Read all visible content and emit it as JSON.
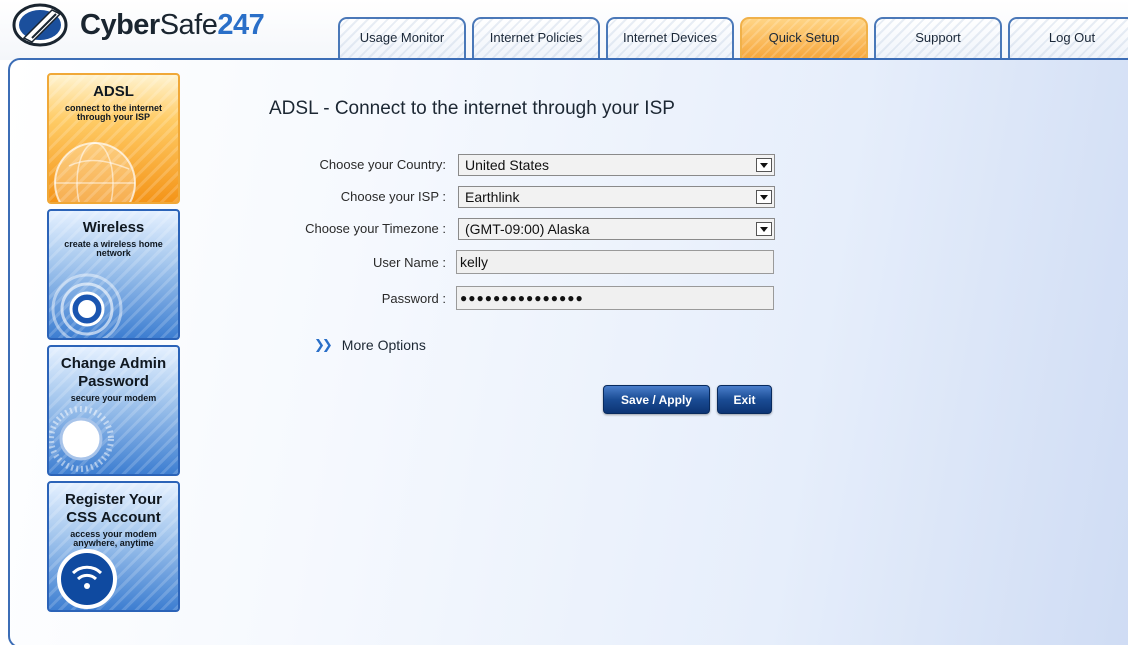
{
  "brand": {
    "part1": "Cyber",
    "part2": "Safe",
    "part3": "247"
  },
  "tabs": [
    {
      "label": "Usage Monitor"
    },
    {
      "label": "Internet Policies"
    },
    {
      "label": "Internet Devices"
    },
    {
      "label": "Quick Setup",
      "active": true
    },
    {
      "label": "Support"
    },
    {
      "label": "Log Out"
    }
  ],
  "sidebar": {
    "cards": [
      {
        "title": "ADSL",
        "subtitle": "connect to the internet through your ISP",
        "active": true
      },
      {
        "title": "Wireless",
        "subtitle": "create a wireless home network"
      },
      {
        "title": "Change Admin Password",
        "subtitle": "secure your modem"
      },
      {
        "title": "Register Your CSS Account",
        "subtitle": "access your modem anywhere, anytime"
      }
    ]
  },
  "main": {
    "title": "ADSL - Connect to the internet through your ISP",
    "form": {
      "country_label": "Choose your Country:",
      "country_value": "United States",
      "isp_label": "Choose your ISP :",
      "isp_value": "Earthlink",
      "timezone_label": "Choose your Timezone :",
      "timezone_value": "(GMT-09:00) Alaska",
      "username_label": "User Name :",
      "username_value": "kelly",
      "password_label": "Password :",
      "password_value": "●●●●●●●●●●●●●●●"
    },
    "more_options": "More Options",
    "save_label": "Save / Apply",
    "exit_label": "Exit"
  },
  "colors": {
    "accent": "#2a6fc8",
    "tab_border": "#4a78b8",
    "active_tab": "#f6a53a",
    "button": "#1a4c94"
  }
}
